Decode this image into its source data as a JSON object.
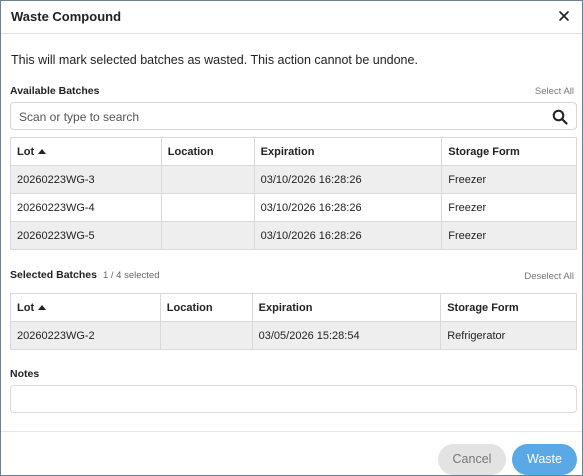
{
  "dialog": {
    "title": "Waste Compound",
    "warning": "This will mark selected batches as wasted. This action cannot be undone."
  },
  "available": {
    "label": "Available Batches",
    "select_all": "Select All",
    "search_placeholder": "Scan or type to search",
    "columns": [
      "Lot",
      "Location",
      "Expiration",
      "Storage Form"
    ],
    "rows": [
      {
        "lot": "20260223WG-3",
        "location": "",
        "expiration": "03/10/2026 16:28:26",
        "storage": "Freezer"
      },
      {
        "lot": "20260223WG-4",
        "location": "",
        "expiration": "03/10/2026 16:28:26",
        "storage": "Freezer"
      },
      {
        "lot": "20260223WG-5",
        "location": "",
        "expiration": "03/10/2026 16:28:26",
        "storage": "Freezer"
      }
    ]
  },
  "selected": {
    "label": "Selected Batches",
    "count": "1 / 4 selected",
    "deselect_all": "Deselect All",
    "columns": [
      "Lot",
      "Location",
      "Expiration",
      "Storage Form"
    ],
    "rows": [
      {
        "lot": "20260223WG-2",
        "location": "",
        "expiration": "03/05/2026 15:28:54",
        "storage": "Refrigerator"
      }
    ]
  },
  "notes": {
    "label": "Notes",
    "value": ""
  },
  "footer": {
    "cancel_label": "Cancel",
    "waste_label": "Waste"
  },
  "colors": {
    "primary": "#5aa9e6",
    "cancel_bg": "#e3e3e3",
    "row_stripe": "#eeeeee"
  }
}
